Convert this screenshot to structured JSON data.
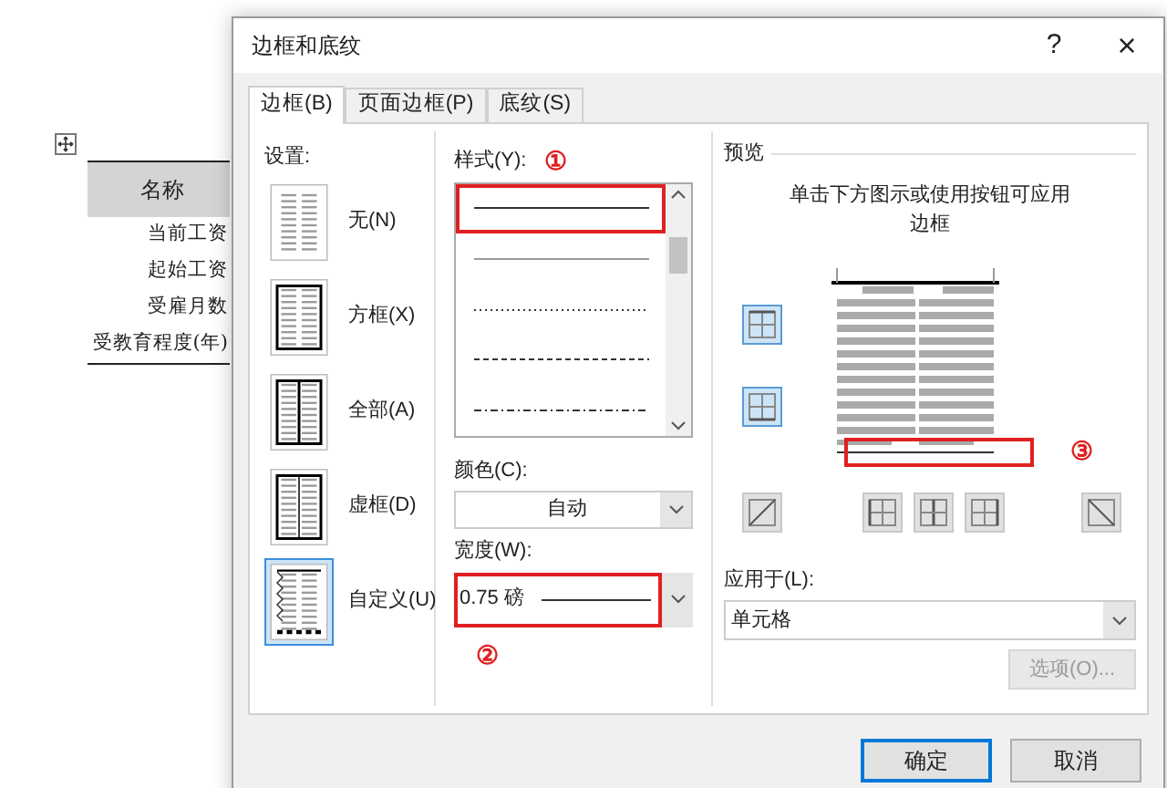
{
  "document": {
    "table": {
      "header": "名称",
      "rows": [
        "当前工资",
        "起始工资",
        "受雇月数",
        "受教育程度(年)"
      ]
    }
  },
  "dialog": {
    "title": "边框和底纹",
    "help": "?",
    "close": "×",
    "tabs": [
      {
        "label": "边框(B)",
        "selected": true
      },
      {
        "label": "页面边框(P)",
        "selected": false
      },
      {
        "label": "底纹(S)",
        "selected": false
      }
    ],
    "settings": {
      "label": "设置:",
      "items": [
        {
          "label": "无(N)",
          "kind": "none",
          "selected": false
        },
        {
          "label": "方框(X)",
          "kind": "box",
          "selected": false
        },
        {
          "label": "全部(A)",
          "kind": "all",
          "selected": false
        },
        {
          "label": "虚框(D)",
          "kind": "grid",
          "selected": false
        },
        {
          "label": "自定义(U)",
          "kind": "custom",
          "selected": true
        }
      ]
    },
    "style": {
      "label": "样式(Y):",
      "annotation": "①",
      "lines": [
        {
          "kind": "solid",
          "selected": true
        },
        {
          "kind": "thin",
          "selected": false
        },
        {
          "kind": "dotted",
          "selected": false
        },
        {
          "kind": "dashed",
          "selected": false
        },
        {
          "kind": "dashdot",
          "selected": false
        }
      ]
    },
    "color": {
      "label": "颜色(C):",
      "value": "自动"
    },
    "width": {
      "label": "宽度(W):",
      "value": "0.75 磅",
      "annotation": "②"
    },
    "preview": {
      "label": "预览",
      "hint": "单击下方图示或使用按钮可应用边框",
      "annotation": "③",
      "side_buttons": [
        {
          "kind": "top",
          "selected": true
        },
        {
          "kind": "bottom",
          "selected": true
        }
      ],
      "bottom_buttons": [
        {
          "kind": "diagonal-up",
          "selected": false
        },
        {
          "kind": "left",
          "selected": false
        },
        {
          "kind": "inner-vertical",
          "selected": false
        },
        {
          "kind": "right",
          "selected": false
        },
        {
          "kind": "diagonal-down",
          "selected": false
        }
      ]
    },
    "apply_to": {
      "label": "应用于(L):",
      "value": "单元格"
    },
    "options_button": {
      "label": "选项(O)...",
      "disabled": true
    },
    "buttons": [
      {
        "label": "确定",
        "kind": "default"
      },
      {
        "label": "取消",
        "kind": "normal"
      }
    ]
  }
}
